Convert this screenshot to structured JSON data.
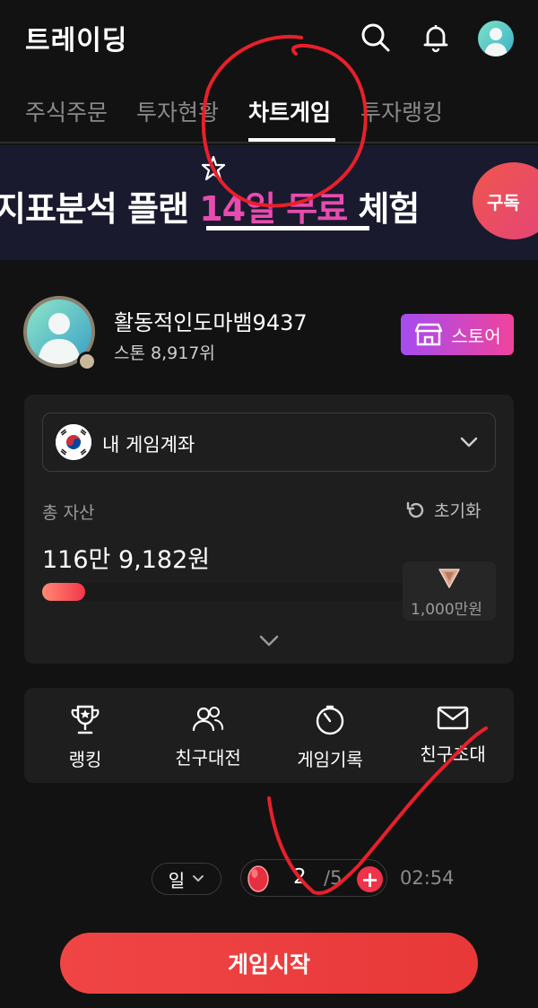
{
  "header": {
    "title": "트레이딩",
    "icons": [
      "search-icon",
      "bell-icon",
      "avatar"
    ]
  },
  "tabs": [
    {
      "label": "주식주문",
      "active": false
    },
    {
      "label": "투자현황",
      "active": false
    },
    {
      "label": "차트게임",
      "active": true
    },
    {
      "label": "투자랭킹",
      "active": false
    }
  ],
  "banner": {
    "text_before": "지표분석 플랜 ",
    "highlight": "14일 무료",
    "text_after": " 체험",
    "badge": "구독"
  },
  "profile": {
    "nickname": "활동적인도마뱀9437",
    "rank": "스톤 8,917위",
    "store_label": "스토어"
  },
  "account": {
    "selected": "내 게임계좌",
    "asset_label": "총 자산",
    "reset_label": "초기화",
    "asset_value": "116만 9,182원",
    "target_label": "1,000만원",
    "progress_fraction": 0.117
  },
  "menu": [
    {
      "label": "랭킹",
      "icon": "trophy-icon"
    },
    {
      "label": "친구대전",
      "icon": "people-icon"
    },
    {
      "label": "게임기록",
      "icon": "timer-icon"
    },
    {
      "label": "친구초대",
      "icon": "mail-icon"
    }
  ],
  "game": {
    "period": "일",
    "energy_count": "2",
    "energy_max": "/5",
    "timer": "02:54",
    "start_label": "게임시작"
  },
  "colors": {
    "accent": "#f04545",
    "tab_active": "#ffffff",
    "store_gradient": [
      "#a64cf0",
      "#f0439c"
    ],
    "annotation": "#e8202a"
  }
}
